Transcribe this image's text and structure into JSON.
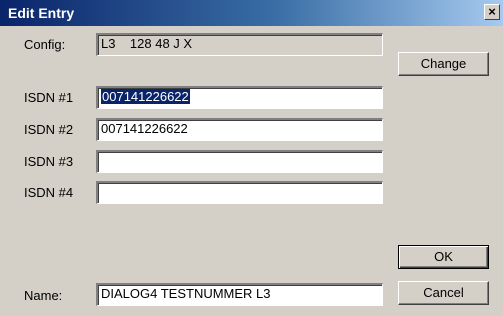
{
  "window": {
    "title": "Edit Entry",
    "close_glyph": "×"
  },
  "form": {
    "config": {
      "label": "Config:",
      "value": "L3    128 48 J X"
    },
    "isdn1": {
      "label": "ISDN #1",
      "value": "007141226622"
    },
    "isdn2": {
      "label": "ISDN #2",
      "value": "007141226622"
    },
    "isdn3": {
      "label": "ISDN #3",
      "value": ""
    },
    "isdn4": {
      "label": "ISDN #4",
      "value": ""
    },
    "name": {
      "label": "Name:",
      "value": "DIALOG4 TESTNUMMER L3"
    }
  },
  "buttons": {
    "change": "Change",
    "ok": "OK",
    "cancel": "Cancel"
  },
  "colors": {
    "titlebar_start": "#0a246a",
    "titlebar_end": "#a6caf0",
    "face": "#d4d0c8",
    "selection": "#0a246a"
  }
}
